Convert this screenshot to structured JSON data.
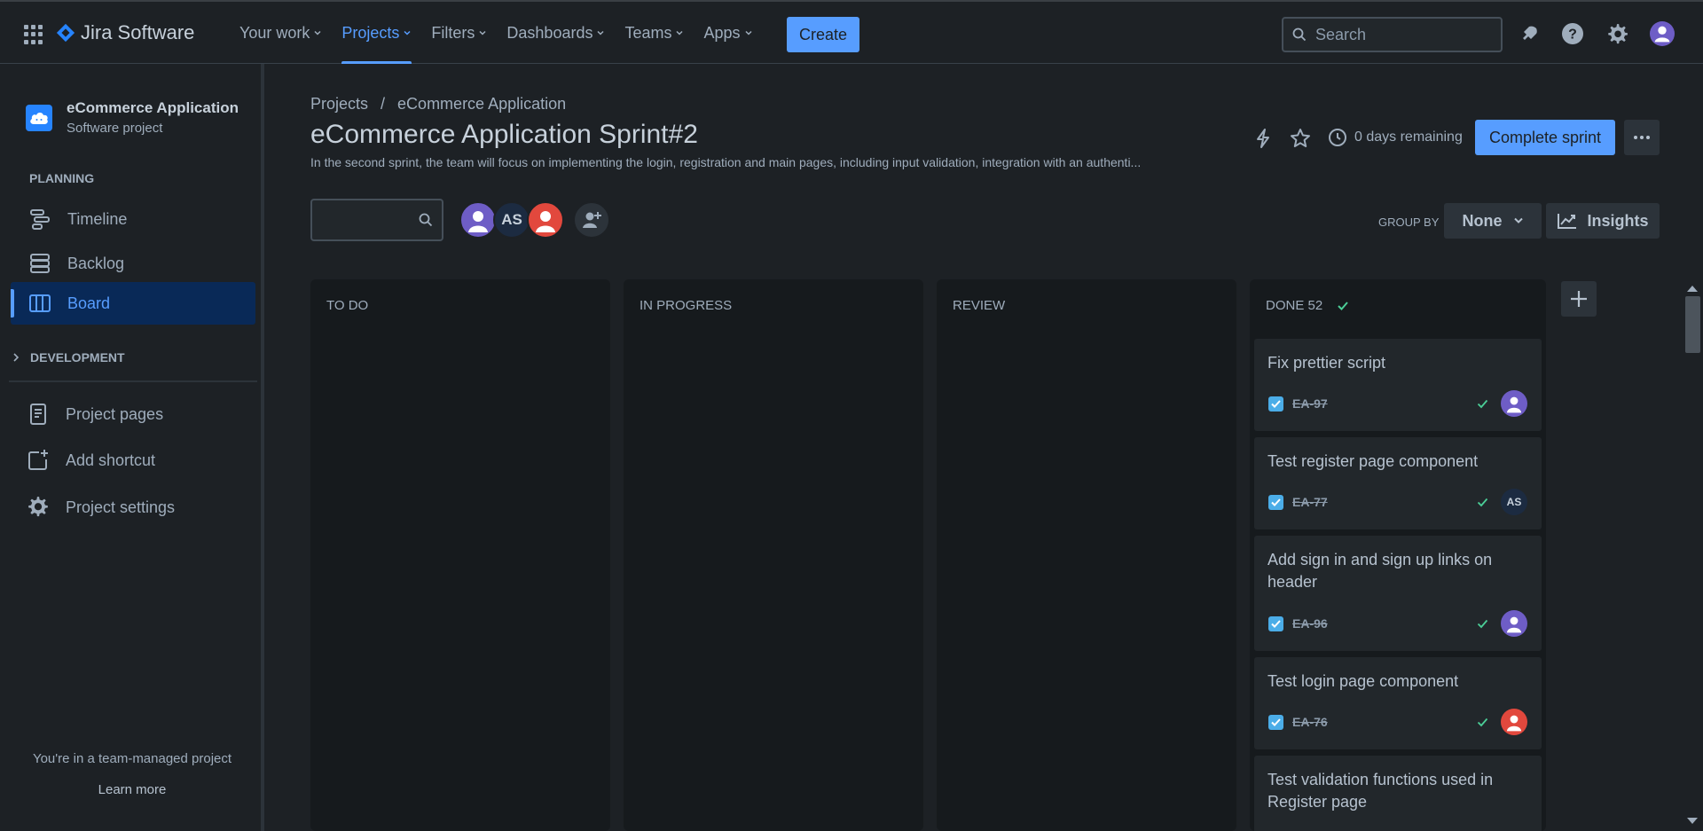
{
  "topbar": {
    "product": "Jira Software",
    "nav": [
      {
        "label": "Your work",
        "active": false
      },
      {
        "label": "Projects",
        "active": true
      },
      {
        "label": "Filters",
        "active": false
      },
      {
        "label": "Dashboards",
        "active": false
      },
      {
        "label": "Teams",
        "active": false
      },
      {
        "label": "Apps",
        "active": false
      }
    ],
    "create_label": "Create",
    "search_placeholder": "Search",
    "icons": [
      "notifications-icon",
      "help-icon",
      "settings-icon",
      "profile-avatar"
    ]
  },
  "sidebar": {
    "project_name": "eCommerce Application",
    "project_type": "Software project",
    "planning_label": "PLANNING",
    "planning_items": [
      {
        "label": "Timeline",
        "icon": "timeline-icon"
      },
      {
        "label": "Backlog",
        "icon": "backlog-icon"
      },
      {
        "label": "Board",
        "icon": "board-icon",
        "active": true
      }
    ],
    "development_label": "DEVELOPMENT",
    "other_items": [
      {
        "label": "Project pages",
        "icon": "page-icon"
      },
      {
        "label": "Add shortcut",
        "icon": "add-shortcut-icon"
      },
      {
        "label": "Project settings",
        "icon": "gear-icon"
      }
    ],
    "footer_text": "You're in a team-managed project",
    "learn_more": "Learn more"
  },
  "main": {
    "breadcrumb": [
      "Projects",
      "eCommerce Application"
    ],
    "breadcrumb_sep": "/",
    "title": "eCommerce Application Sprint#2",
    "description": "In the second sprint, the team will focus on implementing the login, registration and main pages, including input validation, integration with an authenti...",
    "days_remaining": "0 days remaining",
    "complete_label": "Complete sprint",
    "avatar_initials": "AS",
    "group_by_label": "GROUP BY",
    "group_by_value": "None",
    "insights_label": "Insights",
    "columns": [
      {
        "title": "TO DO"
      },
      {
        "title": "IN PROGRESS"
      },
      {
        "title": "REVIEW"
      },
      {
        "title": "DONE 52"
      }
    ],
    "cards": [
      {
        "title": "Fix prettier script",
        "key": "EA-97",
        "assignee": "purple"
      },
      {
        "title": "Test register page component",
        "key": "EA-77",
        "assignee": "AS"
      },
      {
        "title": "Add sign in and sign up links on header",
        "key": "EA-96",
        "assignee": "purple"
      },
      {
        "title": "Test login page component",
        "key": "EA-76",
        "assignee": "red"
      },
      {
        "title": "Test validation functions used in Register page",
        "key": "",
        "assignee": ""
      }
    ]
  },
  "colors": {
    "accent": "#579dff",
    "background": "#1d2125",
    "column": "#161a1d",
    "card": "#22272b",
    "done_green": "#4bce97"
  }
}
